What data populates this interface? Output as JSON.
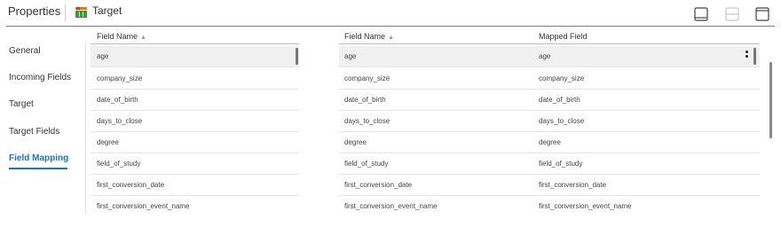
{
  "header": {
    "title": "Properties",
    "object_name": "Target"
  },
  "nav": {
    "items": [
      "General",
      "Incoming Fields",
      "Target",
      "Target Fields",
      "Field Mapping"
    ],
    "active": "Field Mapping"
  },
  "left_table": {
    "header": "Field Name",
    "rows": [
      "age",
      "company_size",
      "date_of_birth",
      "days_to_close",
      "degree",
      "field_of_study",
      "first_conversion_date",
      "first_conversion_event_name"
    ]
  },
  "right_table": {
    "headers": [
      "Field Name",
      "Mapped Field"
    ],
    "rows": [
      [
        "age",
        "age"
      ],
      [
        "company_size",
        "company_size"
      ],
      [
        "date_of_birth",
        "date_of_birth"
      ],
      [
        "days_to_close",
        "days_to_close"
      ],
      [
        "degree",
        "degree"
      ],
      [
        "field_of_study",
        "field_of_study"
      ],
      [
        "first_conversion_date",
        "first_conversion_date"
      ],
      [
        "first_conversion_event_name",
        "first_conversion_event_name"
      ]
    ]
  },
  "icons": {
    "object": "target-table-icon",
    "layout": [
      "panel-single-icon",
      "panel-split-icon",
      "panel-top-icon"
    ],
    "row_menu": "kebab-menu-icon"
  },
  "colors": {
    "accent": "#1a73c7",
    "icon_green": "#3a9a3a",
    "icon_orange": "#e07b1a",
    "icon_red": "#d9362b"
  }
}
